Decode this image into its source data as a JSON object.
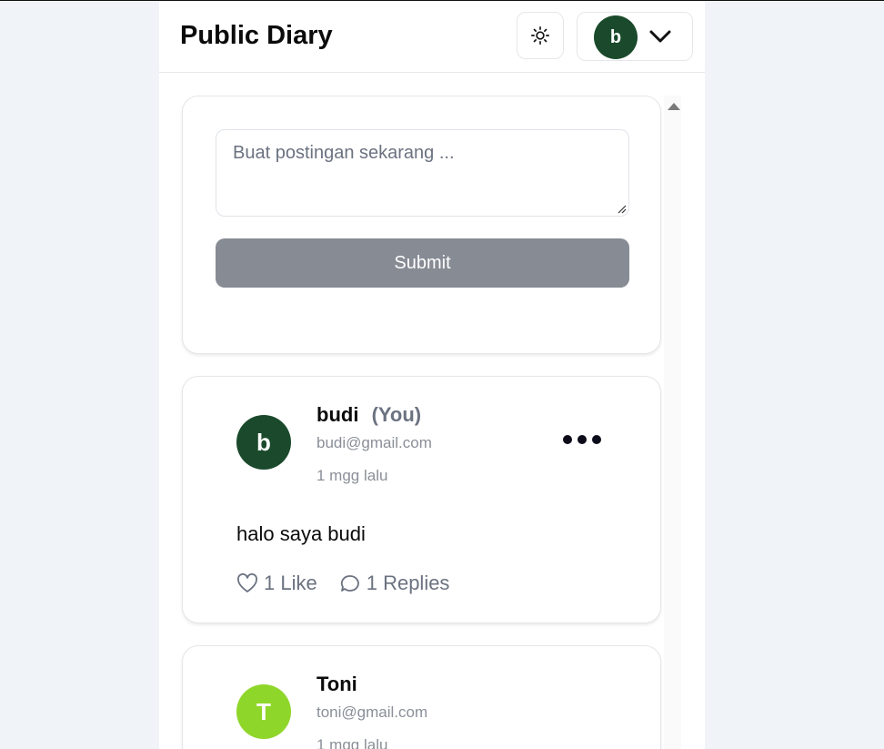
{
  "header": {
    "title": "Public Diary",
    "theme_icon": "sun-icon",
    "user_initial": "b",
    "menu_icon": "chevron-down-icon"
  },
  "composer": {
    "placeholder": "Buat postingan sekarang ...",
    "submit_label": "Submit"
  },
  "posts": [
    {
      "initial": "b",
      "avatar_color": "#1a4a2b",
      "name": "budi",
      "you_label": "(You)",
      "email": "budi@gmail.com",
      "time": "1 mgg lalu",
      "body": "halo saya budi",
      "likes": "1 Like",
      "replies": "1 Replies"
    },
    {
      "initial": "T",
      "avatar_color": "#8fd62a",
      "name": "Toni",
      "email": "toni@gmail.com",
      "time": "1 mgg lalu"
    }
  ]
}
